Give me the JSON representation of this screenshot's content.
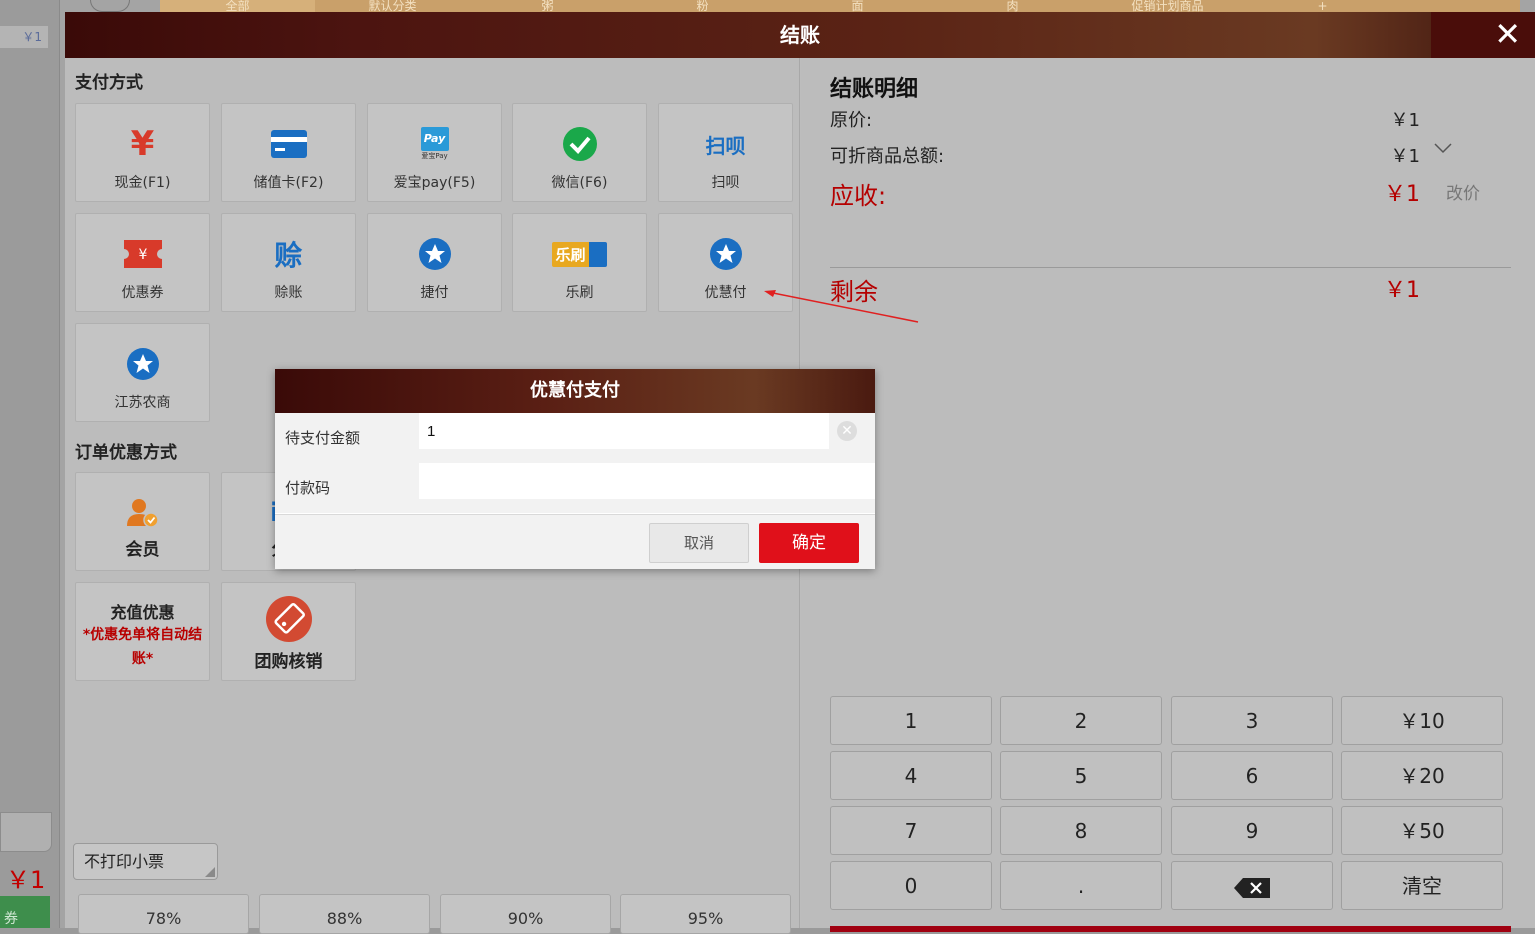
{
  "background": {
    "top_tabs": [
      "全部",
      "默认分类",
      "粥",
      "粉",
      "面",
      "肉",
      "促销计划商品",
      "+"
    ],
    "left_price_tag": "￥1",
    "left_total": "￥1",
    "left_button": "券"
  },
  "modal": {
    "title": "结账",
    "close_glyph": "✕",
    "payment_section_title": "支付方式",
    "payment_methods": [
      {
        "label": "现金(F1)",
        "icon": "yen-icon"
      },
      {
        "label": "储值卡(F2)",
        "icon": "card-icon"
      },
      {
        "label": "爱宝pay(F5)",
        "icon": "aibao-pay-icon",
        "icon_text": "Pay",
        "icon_sub": "爱宝Pay"
      },
      {
        "label": "微信(F6)",
        "icon": "wechat-check-icon"
      },
      {
        "label": "扫呗",
        "icon": "saobei-icon",
        "icon_text": "扫呗"
      },
      {
        "label": "优惠券",
        "icon": "coupon-icon"
      },
      {
        "label": "赊账",
        "icon": "credit-icon",
        "icon_text": "赊"
      },
      {
        "label": "捷付",
        "icon": "star-badge-icon"
      },
      {
        "label": "乐刷",
        "icon": "leshua-icon",
        "icon_text": "乐刷"
      },
      {
        "label": "优慧付",
        "icon": "star-badge-icon"
      },
      {
        "label": "江苏农商",
        "icon": "star-badge-icon"
      }
    ],
    "order_discount_title": "订单优惠方式",
    "order_discounts": [
      {
        "label": "会员",
        "icon": "member-icon"
      },
      {
        "label": "分类",
        "icon": "info-icon"
      }
    ],
    "recharge": {
      "title": "充值优惠",
      "note": "*优惠免单将自动结账*"
    },
    "group_buy": {
      "label": "团购核销",
      "icon": "tag-icon"
    },
    "no_print_label": "不打印小票",
    "discount_buttons": [
      "78%",
      "88%",
      "90%",
      "95%"
    ],
    "detail": {
      "title": "结账明细",
      "original_label": "原价:",
      "original_value": "￥1",
      "discountable_label": "可折商品总额:",
      "discountable_value": "￥1",
      "receivable_label": "应收:",
      "receivable_value": "￥1",
      "change_price_label": "改价",
      "remaining_label": "剩余",
      "remaining_value": "￥1"
    },
    "keypad": [
      [
        "1",
        "2",
        "3",
        "￥10"
      ],
      [
        "4",
        "5",
        "6",
        "￥20"
      ],
      [
        "7",
        "8",
        "9",
        "￥50"
      ],
      [
        "0",
        ".",
        "⌫",
        "清空"
      ]
    ]
  },
  "dialog": {
    "title": "优慧付支付",
    "amount_label": "待支付金额",
    "amount_value": "1",
    "code_label": "付款码",
    "code_value": "",
    "cancel_label": "取消",
    "confirm_label": "确定"
  },
  "colors": {
    "header_dark": "#3a0a08",
    "accent_red": "#e0101a",
    "price_red": "#b50000",
    "icon_blue": "#1a6ec2",
    "icon_red": "#d83a2a"
  }
}
